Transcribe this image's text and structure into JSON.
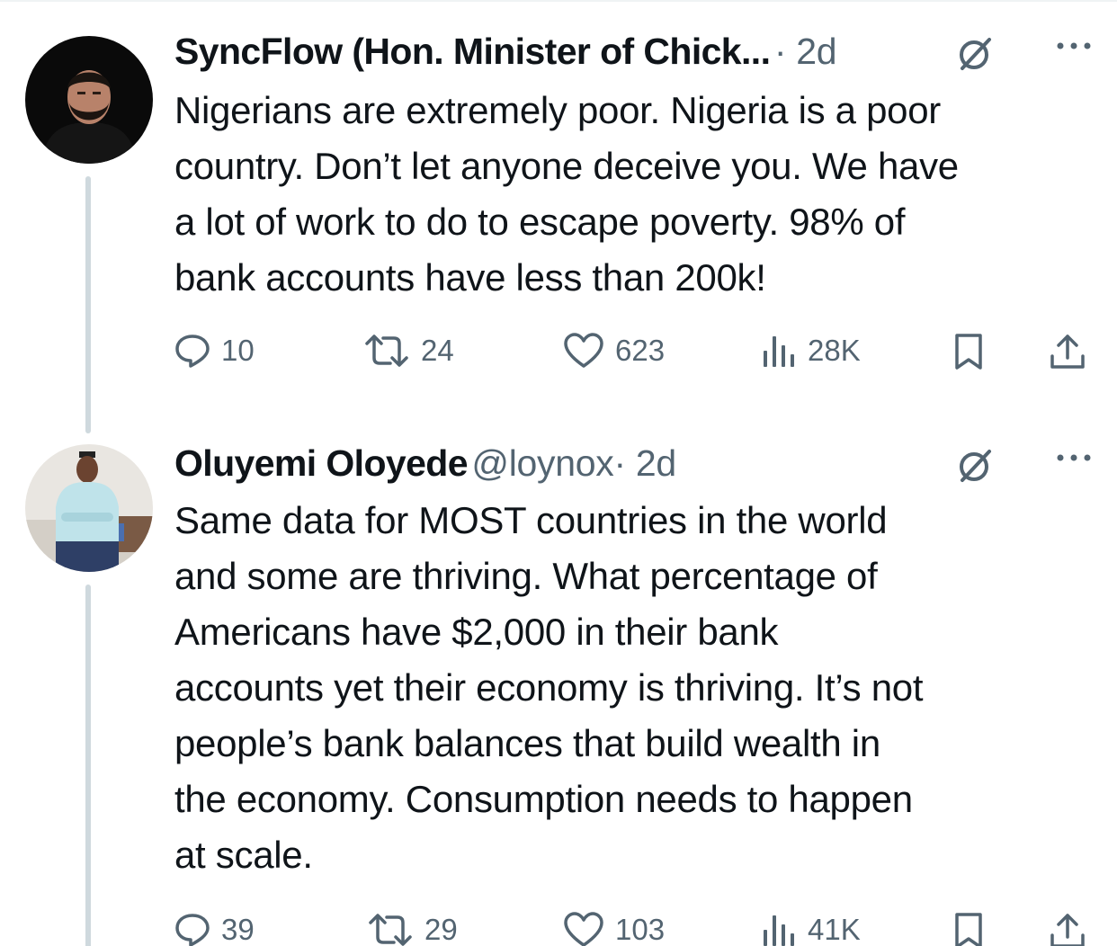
{
  "tweets": [
    {
      "name": "SyncFlow (Hon. Minister of Chick...",
      "meta": "· 2d",
      "text": "Nigerians are extremely poor. Nigeria is a poor\ncountry. Don’t let anyone deceive you. We have\na lot of work to do to escape poverty. 98% of\nbank accounts have less than 200k!",
      "replies": "10",
      "retweets": "24",
      "likes": "623",
      "views": "28K"
    },
    {
      "name": "Oluyemi Oloyede",
      "handle": "@loynox",
      "meta": "· 2d",
      "text": "Same data for MOST countries in the world\nand some are thriving. What percentage of\nAmericans have $2,000 in their bank\naccounts yet their economy is thriving. It’s not\npeople’s bank balances that build wealth in\nthe economy. Consumption needs to happen\nat scale.",
      "replies": "39",
      "retweets": "29",
      "likes": "103",
      "views": "41K"
    }
  ],
  "icons": {
    "reply": "reply-icon",
    "retweet": "retweet-icon",
    "like": "heart-icon",
    "views": "views-icon",
    "bookmark": "bookmark-icon",
    "share": "share-icon",
    "grok": "grok-icon",
    "more": "more-icon"
  },
  "colors": {
    "text": "#0f1419",
    "secondary": "#536471",
    "thread": "#cfd9de"
  }
}
